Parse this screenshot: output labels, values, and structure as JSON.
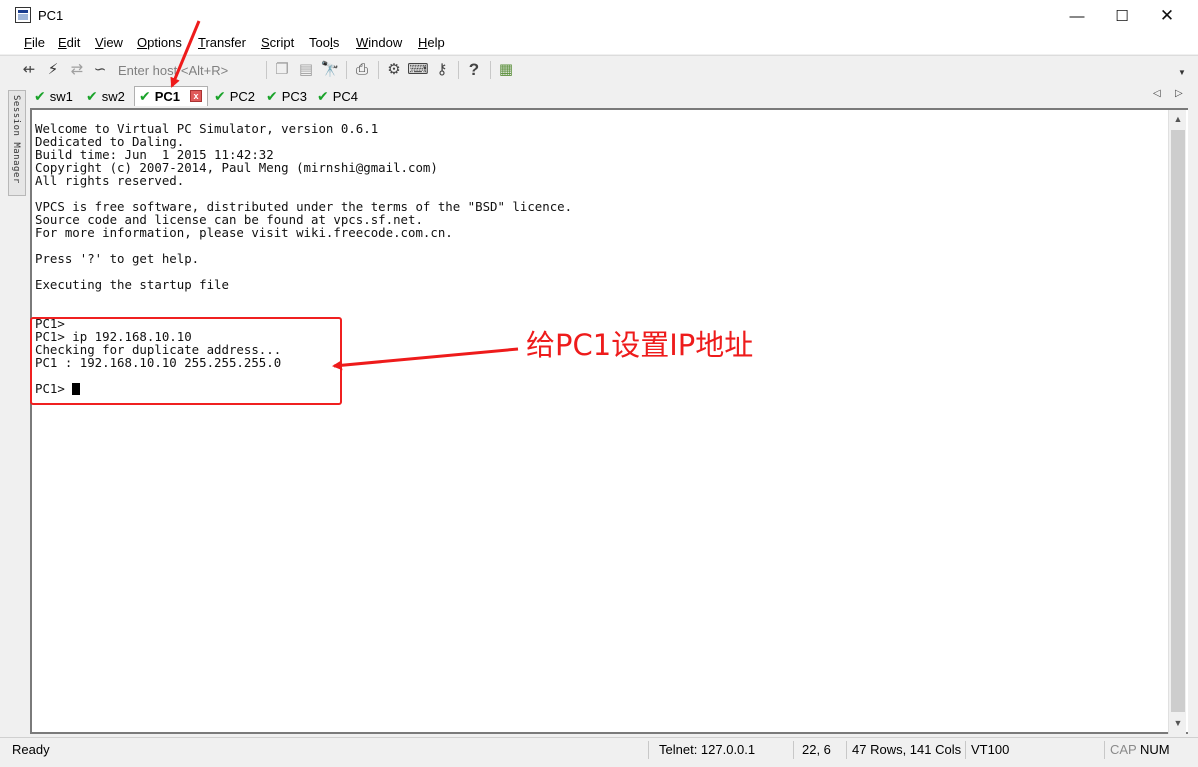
{
  "window": {
    "title": "PC1",
    "min": "—",
    "max": "☐",
    "close": "✕"
  },
  "menu": [
    {
      "pre": "",
      "key": "F",
      "post": "ile"
    },
    {
      "pre": "",
      "key": "E",
      "post": "dit"
    },
    {
      "pre": "",
      "key": "V",
      "post": "iew"
    },
    {
      "pre": "",
      "key": "O",
      "post": "ptions"
    },
    {
      "pre": "",
      "key": "T",
      "post": "ransfer"
    },
    {
      "pre": "",
      "key": "S",
      "post": "cript"
    },
    {
      "pre": "Too",
      "key": "l",
      "post": "s"
    },
    {
      "pre": "",
      "key": "W",
      "post": "indow"
    },
    {
      "pre": "",
      "key": "H",
      "post": "elp"
    }
  ],
  "toolbar": {
    "host_placeholder": "Enter host <Alt+R>",
    "icons": [
      "connect-icon",
      "lightning-icon",
      "reconnect-icon",
      "disconnect-icon",
      "copy-icon",
      "paste-icon",
      "find-icon",
      "print-icon",
      "settings-icon",
      "keymap-icon",
      "key-icon",
      "help-icon",
      "sftp-icon"
    ],
    "glyphs": {
      "connect": "⇷",
      "lightning": "⚡",
      "reconnect": "⇄",
      "disconnect": "∽",
      "copy": "❐",
      "paste": "▤",
      "find": "🔭",
      "print": "⎙",
      "settings": "⚙",
      "keymap": "⌨",
      "key": "⚷",
      "help": "?",
      "sftp": "▦",
      "dropdown": "▼"
    }
  },
  "session_manager": {
    "label": "Session Manager"
  },
  "tabs": [
    {
      "label": "sw1",
      "active": false
    },
    {
      "label": "sw2",
      "active": false
    },
    {
      "label": "PC1",
      "active": true
    },
    {
      "label": "PC2",
      "active": false
    },
    {
      "label": "PC3",
      "active": false
    },
    {
      "label": "PC4",
      "active": false
    }
  ],
  "tab_glyphs": {
    "check": "✔",
    "close": "x",
    "prev": "◁",
    "next": "▷"
  },
  "terminal": {
    "lines": [
      "Welcome to Virtual PC Simulator, version 0.6.1",
      "Dedicated to Daling.",
      "Build time: Jun  1 2015 11:42:32",
      "Copyright (c) 2007-2014, Paul Meng (mirnshi@gmail.com)",
      "All rights reserved.",
      "",
      "VPCS is free software, distributed under the terms of the \"BSD\" licence.",
      "Source code and license can be found at vpcs.sf.net.",
      "For more information, please visit wiki.freecode.com.cn.",
      "",
      "Press '?' to get help.",
      "",
      "Executing the startup file",
      "",
      "",
      "PC1>",
      "PC1> ip 192.168.10.10",
      "Checking for duplicate address...",
      "PC1 : 192.168.10.10 255.255.255.0",
      "",
      "PC1> "
    ]
  },
  "annotation": {
    "text": "给PC1设置IP地址",
    "color": "#ee1b1b"
  },
  "scrollbar": {
    "up": "▲",
    "down": "▼"
  },
  "status": {
    "ready": "Ready",
    "connection": "Telnet: 127.0.0.1",
    "position": "22,   6",
    "size": "47 Rows, 141 Cols",
    "emulation": "VT100",
    "cap": "CAP",
    "num": "NUM"
  }
}
